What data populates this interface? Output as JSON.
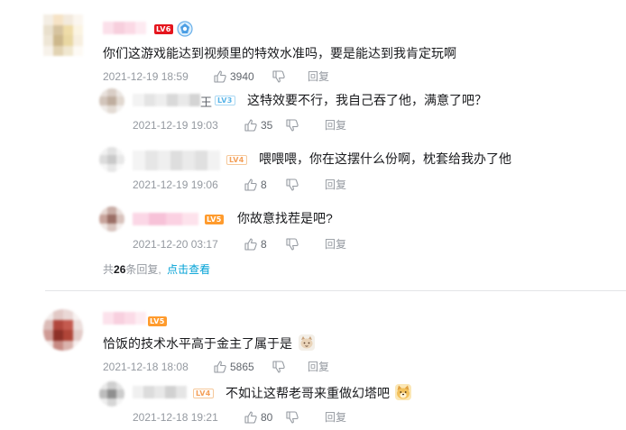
{
  "comments": [
    {
      "text": "你们这游戏能达到视频里的特效水准吗，要是能达到我肯定玩啊",
      "level": "LV6",
      "date": "2021-12-19 18:59",
      "likes": "3940",
      "reply_label": "回复",
      "replies": [
        {
          "name_suffix": "王",
          "level": "LV3",
          "text": "这特效要不行，我自己吞了他，满意了吧？",
          "date": "2021-12-19 19:03",
          "likes": "35",
          "reply_label": "回复"
        },
        {
          "level": "LV4",
          "text": "喂喂喂，你在这摆什么份啊，枕套给我办了他",
          "date": "2021-12-19 19:06",
          "likes": "8",
          "reply_label": "回复"
        },
        {
          "level": "LV5",
          "text": "你故意找茬是吧?",
          "date": "2021-12-20 03:17",
          "likes": "8",
          "reply_label": "回复"
        }
      ],
      "more": {
        "prefix": "共",
        "count": "26",
        "suffix": "条回复,",
        "link": "点击查看"
      }
    },
    {
      "text": "恰饭的技术水平高于金主了属于是",
      "level": "LV5",
      "date": "2021-12-18 18:08",
      "likes": "5865",
      "reply_label": "回复",
      "replies": [
        {
          "level": "LV4",
          "text": "不如让这帮老哥来重做幻塔吧",
          "date": "2021-12-18 19:21",
          "likes": "80",
          "reply_label": "回复"
        }
      ]
    }
  ],
  "icons": {
    "like": "thumbs-up-icon",
    "dislike": "thumbs-down-icon",
    "badge": "guard-badge-icon",
    "emoji_cat": "cat-face-emoji",
    "emoji_dog": "doge-face-emoji"
  },
  "colors": {
    "text": "#18191c",
    "meta": "#9499a0",
    "link": "#00a1d6",
    "lv6": "#e5151d",
    "lv5": "#ff9b2d"
  }
}
